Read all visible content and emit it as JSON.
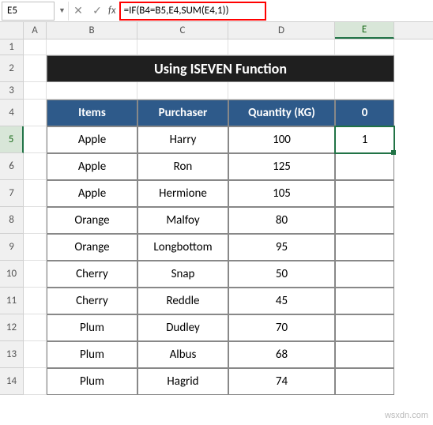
{
  "formula_bar": {
    "cell_ref": "E5",
    "formula": "=IF(B4=B5,E4,SUM(E4,1))"
  },
  "columns": [
    "A",
    "B",
    "C",
    "D",
    "E"
  ],
  "active_col": "E",
  "active_row": 5,
  "title": "Using ISEVEN Function",
  "headers": {
    "items": "Items",
    "purchaser": "Purchaser",
    "quantity": "Quantity (KG)",
    "ecol": "0"
  },
  "rows": [
    {
      "items": "Apple",
      "purchaser": "Harry",
      "quantity": "100",
      "e": "1"
    },
    {
      "items": "Apple",
      "purchaser": "Ron",
      "quantity": "125",
      "e": ""
    },
    {
      "items": "Apple",
      "purchaser": "Hermione",
      "quantity": "105",
      "e": ""
    },
    {
      "items": "Orange",
      "purchaser": "Malfoy",
      "quantity": "80",
      "e": ""
    },
    {
      "items": "Orange",
      "purchaser": "Longbottom",
      "quantity": "95",
      "e": ""
    },
    {
      "items": "Cherry",
      "purchaser": "Snap",
      "quantity": "50",
      "e": ""
    },
    {
      "items": "Cherry",
      "purchaser": "Reddle",
      "quantity": "45",
      "e": ""
    },
    {
      "items": "Plum",
      "purchaser": "Dudley",
      "quantity": "70",
      "e": ""
    },
    {
      "items": "Plum",
      "purchaser": "Albus",
      "quantity": "68",
      "e": ""
    },
    {
      "items": "Plum",
      "purchaser": "Hagrid",
      "quantity": "74",
      "e": ""
    }
  ],
  "watermark": "wsxdn.com",
  "chart_data": {
    "type": "table",
    "title": "Using ISEVEN Function",
    "columns": [
      "Items",
      "Purchaser",
      "Quantity (KG)",
      "0"
    ],
    "rows": [
      [
        "Apple",
        "Harry",
        100,
        1
      ],
      [
        "Apple",
        "Ron",
        125,
        null
      ],
      [
        "Apple",
        "Hermione",
        105,
        null
      ],
      [
        "Orange",
        "Malfoy",
        80,
        null
      ],
      [
        "Orange",
        "Longbottom",
        95,
        null
      ],
      [
        "Cherry",
        "Snap",
        50,
        null
      ],
      [
        "Cherry",
        "Reddle",
        45,
        null
      ],
      [
        "Plum",
        "Dudley",
        70,
        null
      ],
      [
        "Plum",
        "Albus",
        68,
        null
      ],
      [
        "Plum",
        "Hagrid",
        74,
        null
      ]
    ]
  }
}
